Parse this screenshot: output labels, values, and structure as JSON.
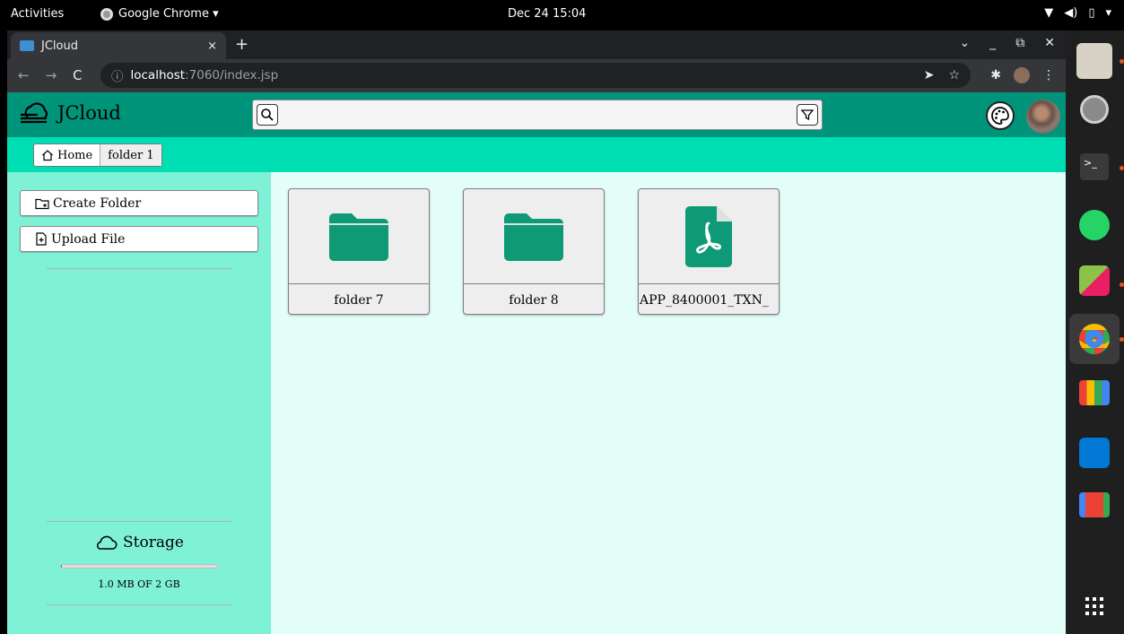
{
  "system": {
    "activities": "Activities",
    "app_name": "Google Chrome ▾",
    "clock": "Dec 24 15:04"
  },
  "browser": {
    "tab_title": "JCloud",
    "tab_close": "×",
    "new_tab": "+",
    "url_host": "localhost",
    "url_path": ":7060/index.jsp"
  },
  "app": {
    "brand": "JCloud",
    "search_placeholder": "",
    "breadcrumbs": [
      "Home",
      "folder 1"
    ]
  },
  "sidebar": {
    "create_folder": "Create Folder",
    "upload_file": "Upload File",
    "storage_title": "Storage",
    "storage_text": "1.0 MB OF 2 GB",
    "storage_used_fraction": 0.0005
  },
  "files": [
    {
      "name": "folder 7",
      "type": "folder"
    },
    {
      "name": "folder 8",
      "type": "folder"
    },
    {
      "name": "APP_8400001_TXN_",
      "type": "pdf"
    }
  ],
  "colors": {
    "appbar": "#00957a",
    "crumbbar": "#00dfb4",
    "sidebar": "#7ff1d6",
    "content": "#e3fdf9",
    "icon_green": "#0e9a76"
  }
}
